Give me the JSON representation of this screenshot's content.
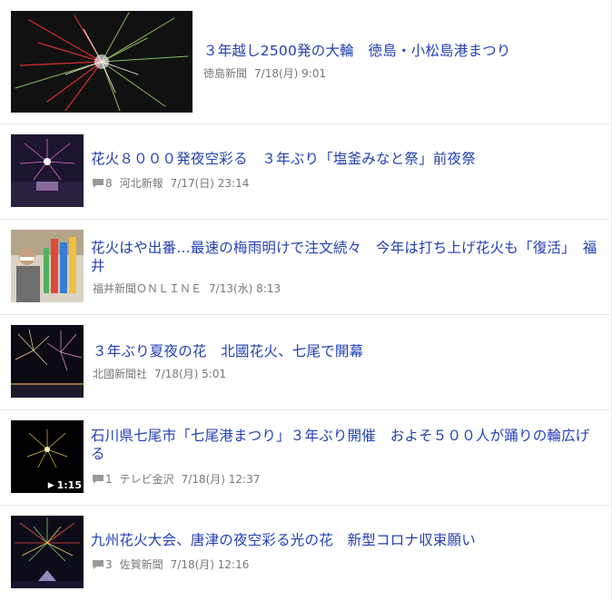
{
  "articles": [
    {
      "title": "３年越し2500発の大輪　徳島・小松島港まつり",
      "source": "徳島新聞",
      "time": "7/18(月) 9:01",
      "comments": "",
      "duration": ""
    },
    {
      "title": "花火８０００発夜空彩る　３年ぶり「塩釜みなと祭」前夜祭",
      "source": "河北新報",
      "time": "7/17(日) 23:14",
      "comments": "8",
      "duration": ""
    },
    {
      "title": "花火はや出番…最速の梅雨明けで注文続々　今年は打ち上げ花火も「復活」　福井",
      "source": "福井新聞ＯＮＬＩＮＥ",
      "time": "7/13(水) 8:13",
      "comments": "",
      "duration": ""
    },
    {
      "title": "３年ぶり夏夜の花　北國花火、七尾で開幕",
      "source": "北國新聞社",
      "time": "7/18(月) 5:01",
      "comments": "",
      "duration": ""
    },
    {
      "title": "石川県七尾市「七尾港まつり」３年ぶり開催　およそ５００人が踊りの輪広げる",
      "source": "テレビ金沢",
      "time": "7/18(月) 12:37",
      "comments": "1",
      "duration": "1:15"
    },
    {
      "title": "九州花火大会、唐津の夜空彩る光の花　新型コロナ収束願い",
      "source": "佐賀新聞",
      "time": "7/18(月) 12:16",
      "comments": "3",
      "duration": ""
    }
  ],
  "icons": {
    "comment": "comment-bubble-icon",
    "play": "play-icon"
  }
}
